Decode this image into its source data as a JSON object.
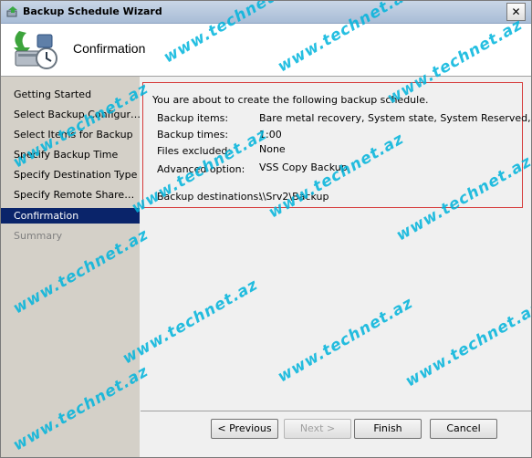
{
  "window": {
    "title": "Backup Schedule Wizard",
    "close_symbol": "✕"
  },
  "header": {
    "title": "Confirmation",
    "icon": "backup-wizard-icon"
  },
  "sidebar": {
    "items": [
      {
        "label": "Getting Started",
        "state": "normal"
      },
      {
        "label": "Select Backup Configur…",
        "state": "normal"
      },
      {
        "label": "Select Items for Backup",
        "state": "normal"
      },
      {
        "label": "Specify Backup Time",
        "state": "normal"
      },
      {
        "label": "Specify Destination Type",
        "state": "normal"
      },
      {
        "label": "Specify Remote Share…",
        "state": "normal"
      },
      {
        "label": "Confirmation",
        "state": "active"
      },
      {
        "label": "Summary",
        "state": "disabled"
      }
    ]
  },
  "confirmation": {
    "intro": "You are about to create the following backup schedule.",
    "rows": [
      {
        "label": "Backup items:",
        "value": "Bare metal recovery, System state, System Reserved, …"
      },
      {
        "label": "Backup times:",
        "value": "1:00"
      },
      {
        "label": "Files excluded:",
        "value": "None"
      },
      {
        "label": "Advanced option:",
        "value": "VSS Copy Backup"
      },
      {
        "label": "Backup destinations:",
        "value": "\\\\Srv2\\Backup"
      }
    ]
  },
  "buttons": {
    "previous": "< Previous",
    "next": "Next >",
    "finish": "Finish",
    "cancel": "Cancel"
  },
  "watermark": "www.technet.az",
  "colors": {
    "active_nav": "#0a246a",
    "highlight_border": "#d63a3a",
    "watermark": "#00b4dc"
  }
}
